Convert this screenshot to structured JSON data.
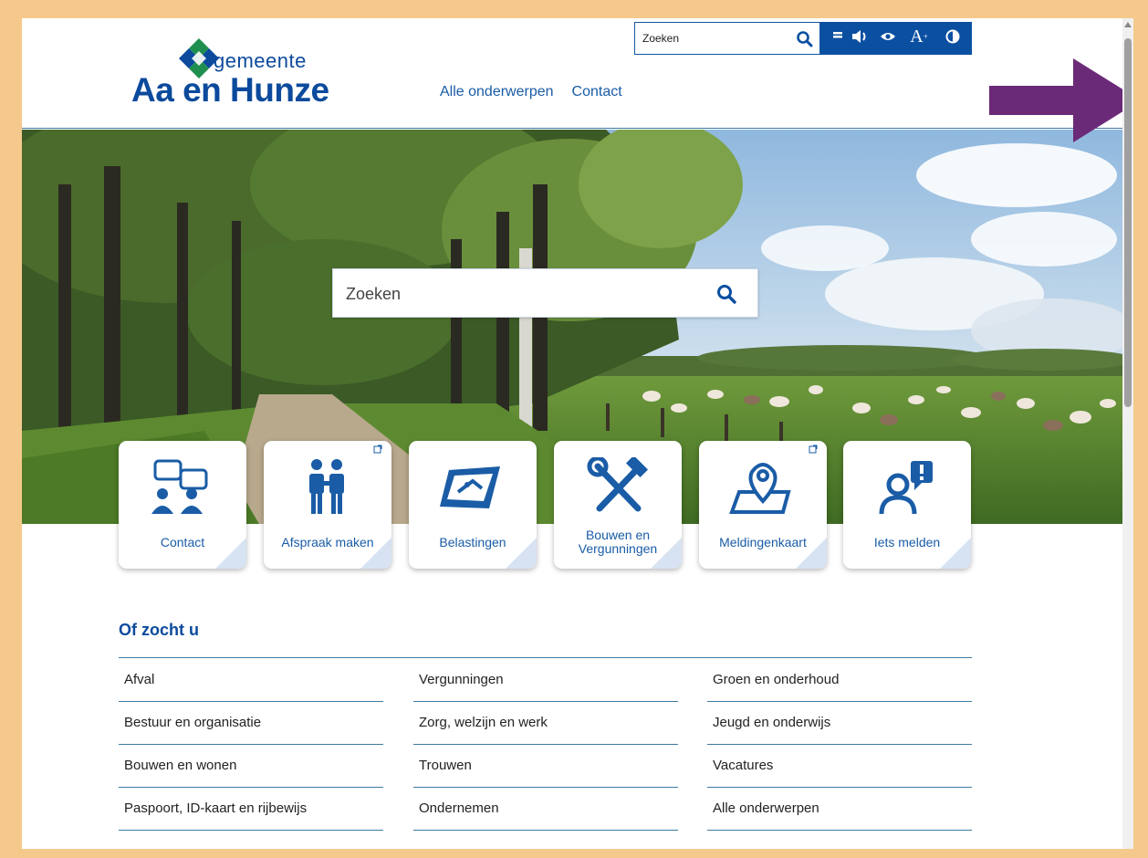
{
  "header": {
    "logo_small": "gemeente",
    "logo_big": "Aa en Hunze",
    "top_search_placeholder": "Zoeken",
    "nav": [
      "Alle onderwerpen",
      "Contact"
    ],
    "toolbar_icons": [
      "menu-icon",
      "speaker-icon",
      "eye-icon",
      "text-size-icon",
      "contrast-icon"
    ],
    "toolbar_text_size_label": "A"
  },
  "hero": {
    "search_placeholder": "Zoeken"
  },
  "tiles": [
    {
      "label": "Contact",
      "icon": "contact-people-icon",
      "external": false
    },
    {
      "label": "Afspraak maken",
      "icon": "appointment-icon",
      "external": true
    },
    {
      "label": "Belastingen",
      "icon": "tax-card-icon",
      "external": false
    },
    {
      "label": "Bouwen en Vergunningen",
      "label_line1": "Bouwen en",
      "label_line2": "Vergunningen",
      "icon": "hammer-wrench-icon",
      "external": false
    },
    {
      "label": "Meldingenkaart",
      "icon": "map-pin-icon",
      "external": true
    },
    {
      "label": "Iets melden",
      "icon": "report-person-icon",
      "external": false
    }
  ],
  "of_zocht_u": {
    "title": "Of zocht u",
    "columns": [
      [
        "Afval",
        "Bestuur en organisatie",
        "Bouwen en wonen",
        "Paspoort, ID-kaart en rijbewijs"
      ],
      [
        "Vergunningen",
        "Zorg, welzijn en werk",
        "Trouwen",
        "Ondernemen"
      ],
      [
        "Groen en onderhoud",
        "Jeugd en onderwijs",
        "Vacatures",
        "Alle onderwerpen"
      ]
    ]
  },
  "colors": {
    "brand_blue": "#0b4a9c",
    "link_blue": "#1a5ca6",
    "annotation_arrow": "#6b2a78",
    "frame_background": "#f5c98c"
  }
}
